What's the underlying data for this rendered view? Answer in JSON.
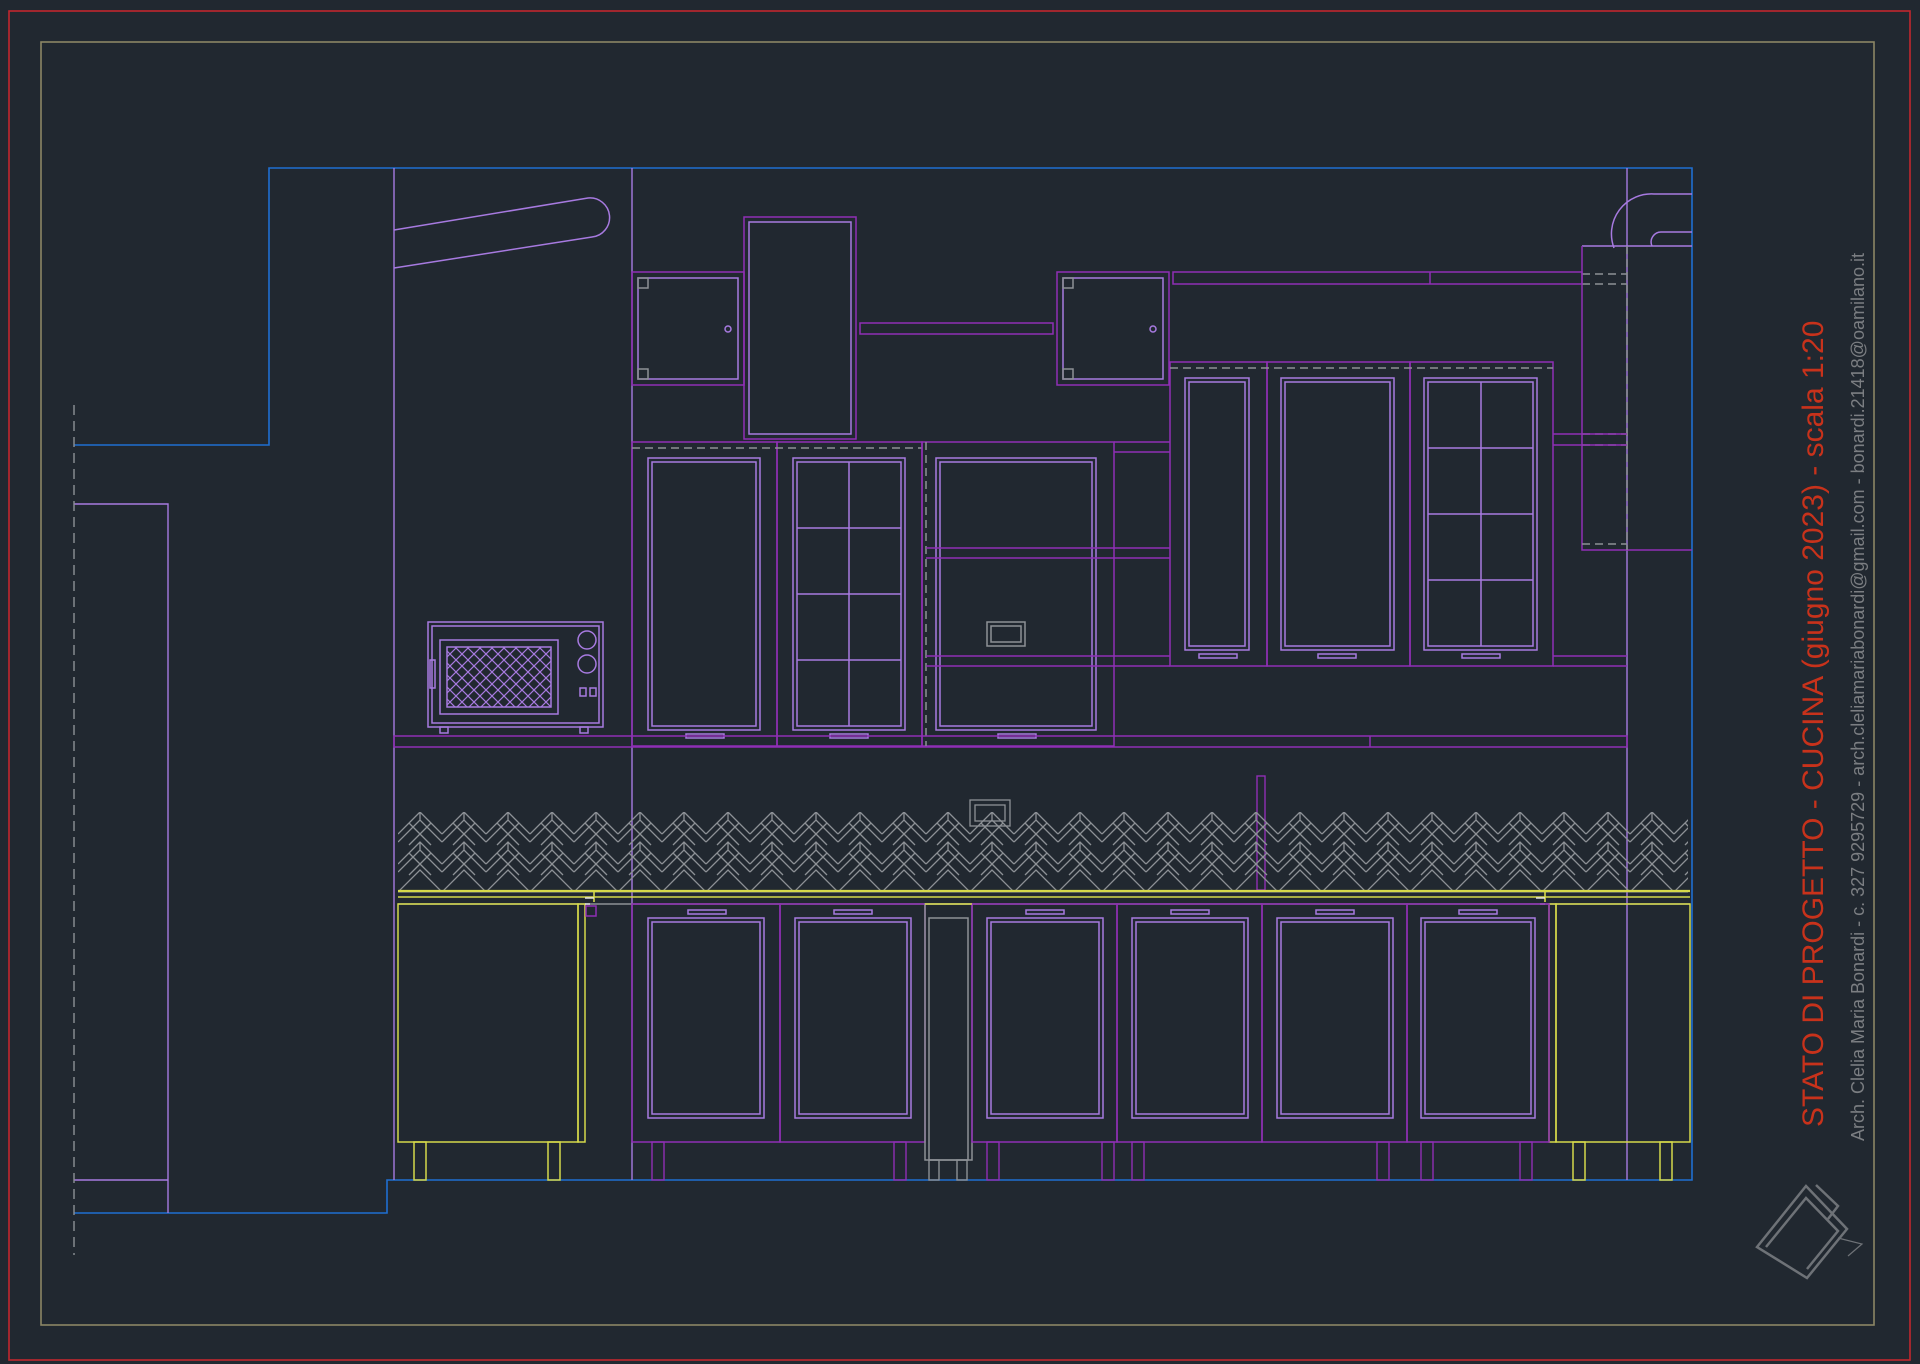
{
  "title_block": {
    "title": "STATO DI PROGETTO - CUCINA (giugno 2023) - scala 1:20",
    "subtitle": "Arch. Clelia Maria Bonardi  -  c. 327 9295729  -  arch.cleliamariabonardi@gmail.com  -  bonardi.21418@oamilano.it"
  },
  "colors": {
    "background": "#212830",
    "outer_border": "#c1272d",
    "inner_border": "#8c8664",
    "wall": "#1f6fd1",
    "cabinet": "#8f2fb5",
    "cabinet_inner": "#a77ae0",
    "yellow": "#d6d94a",
    "gray": "#8d9196",
    "title": "#c8321b",
    "subtitle": "#7b7e82"
  },
  "icons": [
    "architect-logo-icon",
    "microwave-icon",
    "herringbone-backsplash-icon"
  ]
}
